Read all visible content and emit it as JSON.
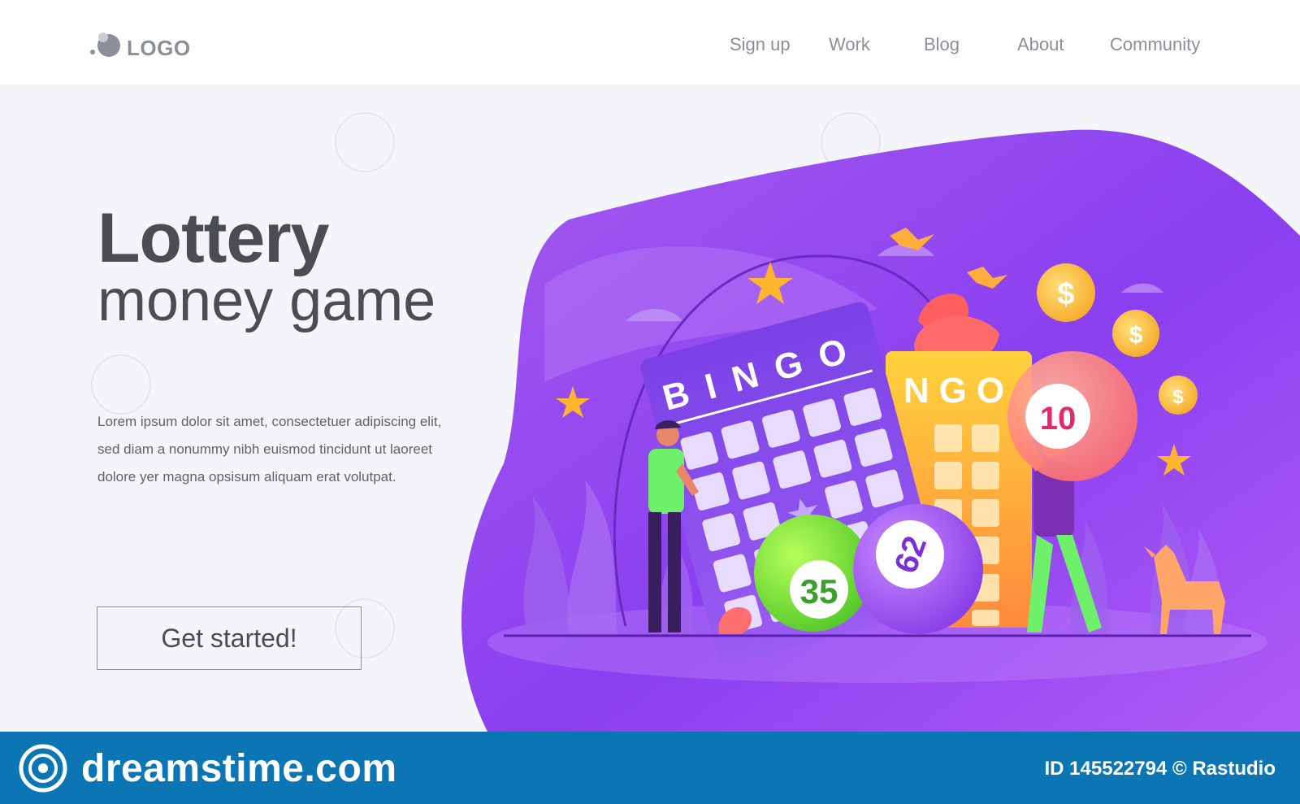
{
  "header": {
    "logo_text": "LOGO",
    "nav": [
      {
        "label": "Sign up"
      },
      {
        "label": "Work"
      },
      {
        "label": "Blog"
      },
      {
        "label": "About"
      },
      {
        "label": "Community"
      }
    ]
  },
  "hero": {
    "title": "Lottery",
    "subtitle": "money game",
    "body": "Lorem ipsum dolor sit amet, consectetuer adipiscing elit, sed diam a  nonummy nibh euismod tincidunt ut laoreet dolore yer magna opsisum aliquam erat volutpat.",
    "cta_label": "Get started!"
  },
  "illustration": {
    "card_front_text": "BINGO",
    "card_back_text": "NGO",
    "balls": [
      "35",
      "62",
      "10"
    ]
  },
  "footer": {
    "brand": "dreamstime.com",
    "id_text": "ID 145522794 © Rastudio"
  },
  "colors": {
    "accent_purple": "#8f3ff0",
    "blob_light": "#b56ff5",
    "footer_blue": "#0c76b5",
    "text_dark": "#4a4d52",
    "text_muted": "#8a8f98"
  }
}
